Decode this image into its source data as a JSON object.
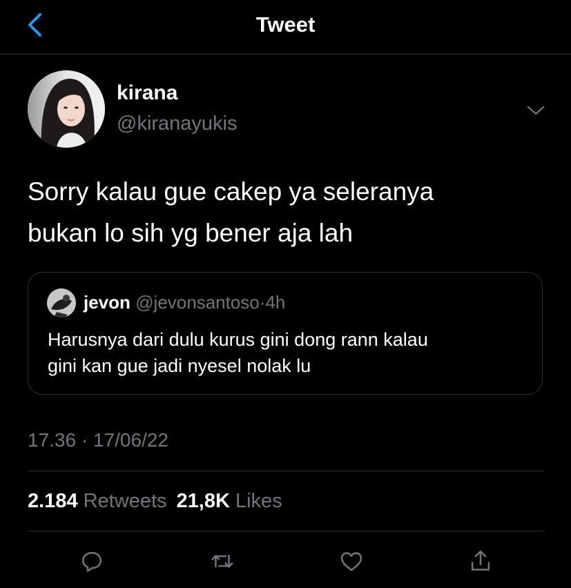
{
  "header": {
    "title": "Tweet",
    "back_icon": "chevron-left-icon"
  },
  "author": {
    "display_name": "kirana",
    "handle": "@kiranayukis",
    "avatar_icon": "profile-photo",
    "caret_icon": "chevron-down-icon"
  },
  "tweet": {
    "text": "Sorry kalau gue cakep ya seleranya\nbukan lo sih yg bener aja lah"
  },
  "quote": {
    "display_name": "jevon",
    "handle": "@jevonsantoso",
    "separator": "·",
    "time": "4h",
    "text": "Harusnya dari dulu kurus gini dong rann kalau\ngini kan gue jadi nyesel nolak lu"
  },
  "timestamp": "17.36 · 17/06/22",
  "stats": {
    "retweets_count": "2.184",
    "retweets_label": "Retweets",
    "likes_count": "21,8K",
    "likes_label": "Likes"
  },
  "actions": [
    {
      "name": "reply",
      "icon": "reply-icon"
    },
    {
      "name": "retweet",
      "icon": "retweet-icon"
    },
    {
      "name": "like",
      "icon": "heart-icon"
    },
    {
      "name": "share",
      "icon": "share-icon"
    }
  ],
  "colors": {
    "background": "#000000",
    "text": "#ffffff",
    "secondary": "#71767b",
    "accent": "#1d9bf0",
    "border": "#2f3336"
  }
}
